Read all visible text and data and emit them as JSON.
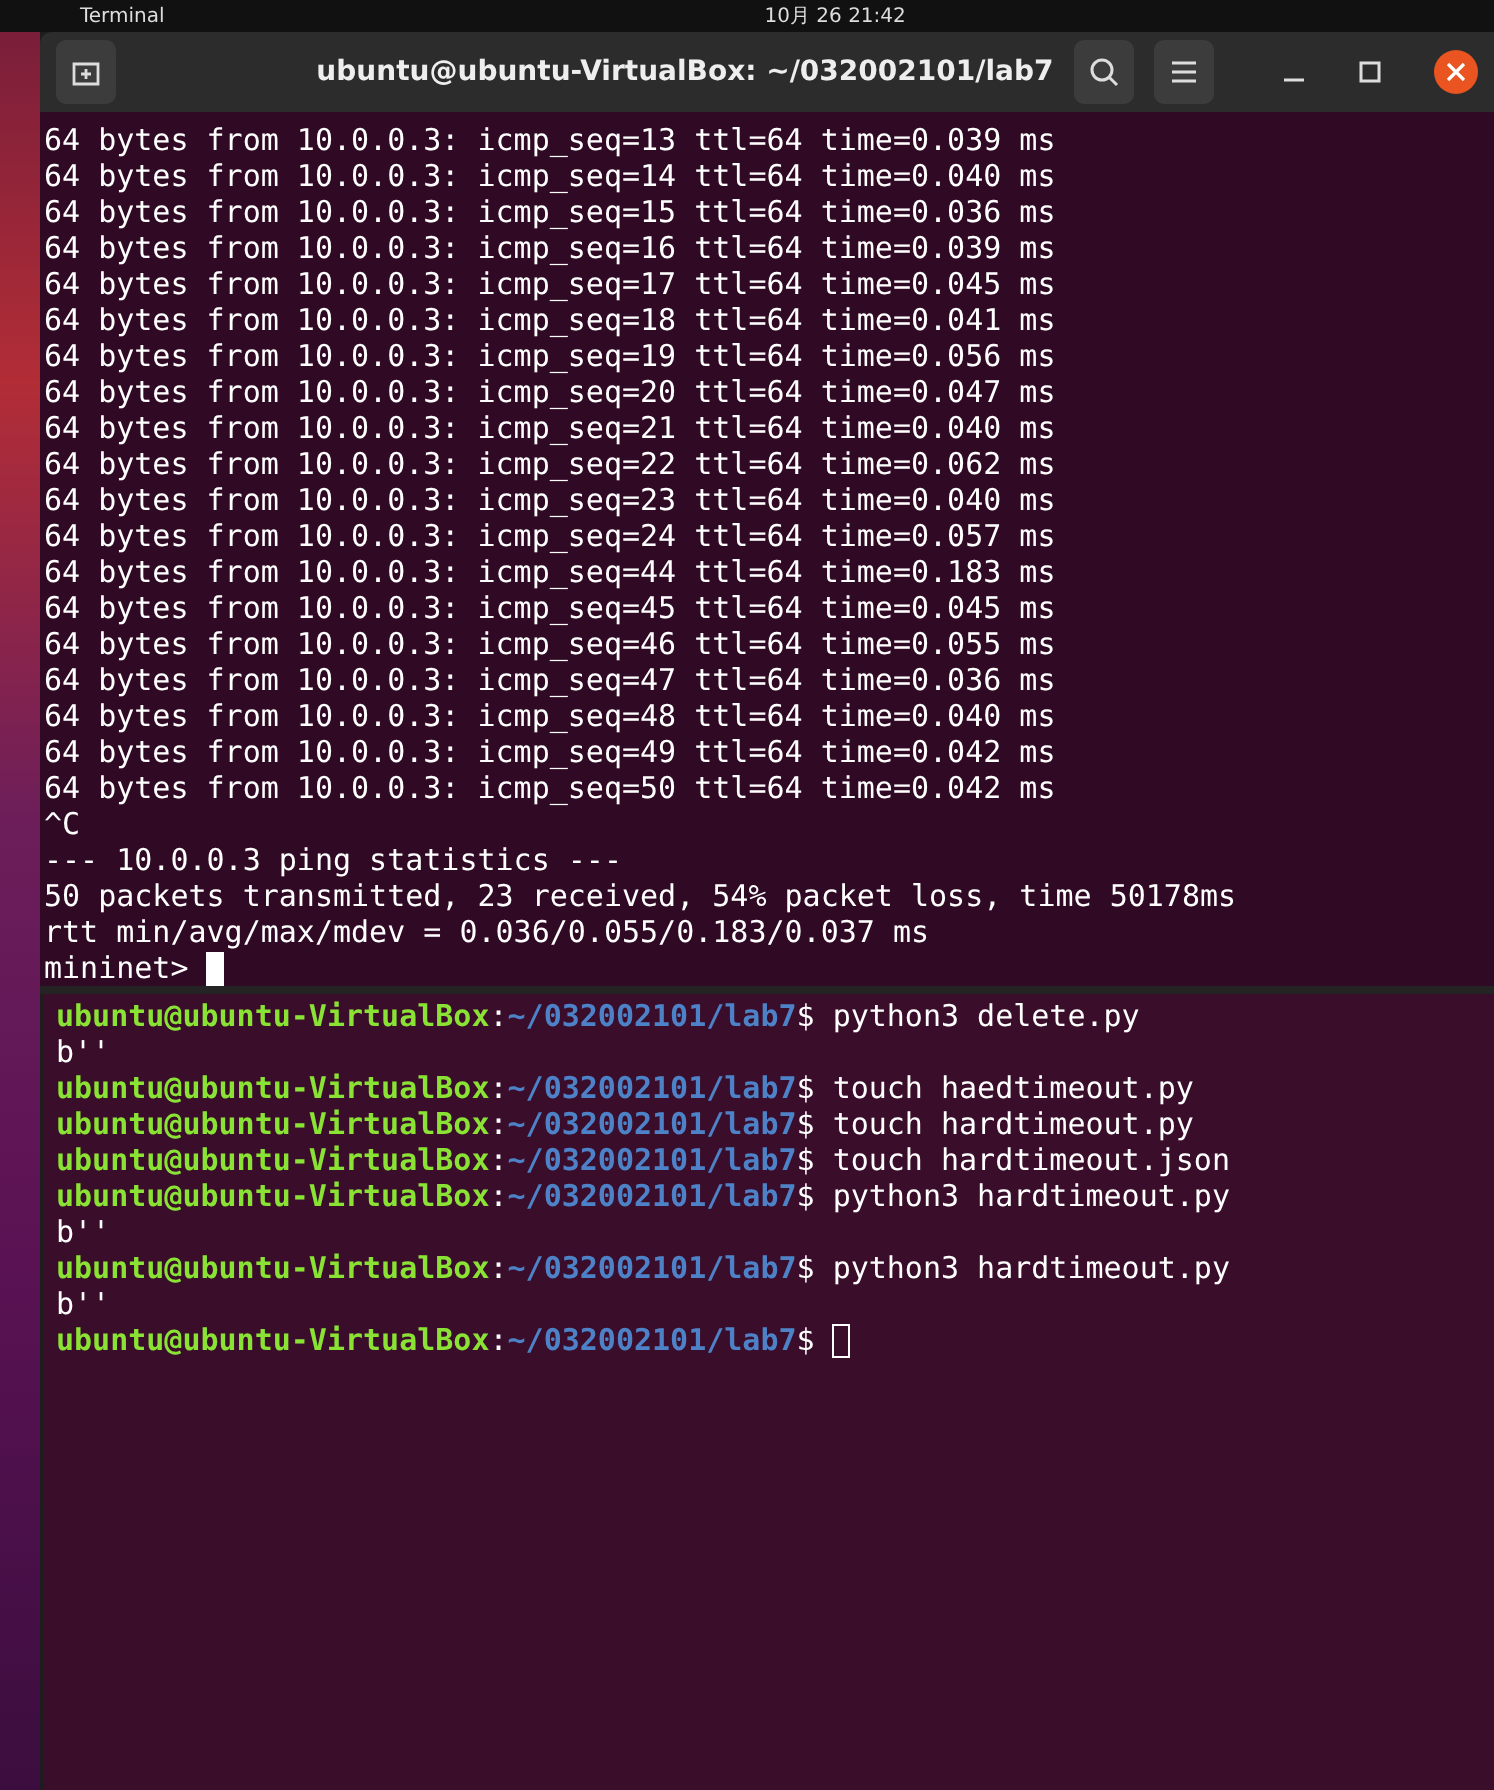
{
  "top_bar": {
    "app": "Terminal",
    "clock": "10月 26 21:42"
  },
  "window": {
    "title": "ubuntu@ubuntu-VirtualBox: ~/032002101/lab7"
  },
  "upper_pane": {
    "cursor_focused": true,
    "lines": [
      "64 bytes from 10.0.0.3: icmp_seq=13 ttl=64 time=0.039 ms",
      "64 bytes from 10.0.0.3: icmp_seq=14 ttl=64 time=0.040 ms",
      "64 bytes from 10.0.0.3: icmp_seq=15 ttl=64 time=0.036 ms",
      "64 bytes from 10.0.0.3: icmp_seq=16 ttl=64 time=0.039 ms",
      "64 bytes from 10.0.0.3: icmp_seq=17 ttl=64 time=0.045 ms",
      "64 bytes from 10.0.0.3: icmp_seq=18 ttl=64 time=0.041 ms",
      "64 bytes from 10.0.0.3: icmp_seq=19 ttl=64 time=0.056 ms",
      "64 bytes from 10.0.0.3: icmp_seq=20 ttl=64 time=0.047 ms",
      "64 bytes from 10.0.0.3: icmp_seq=21 ttl=64 time=0.040 ms",
      "64 bytes from 10.0.0.3: icmp_seq=22 ttl=64 time=0.062 ms",
      "64 bytes from 10.0.0.3: icmp_seq=23 ttl=64 time=0.040 ms",
      "64 bytes from 10.0.0.3: icmp_seq=24 ttl=64 time=0.057 ms",
      "64 bytes from 10.0.0.3: icmp_seq=44 ttl=64 time=0.183 ms",
      "64 bytes from 10.0.0.3: icmp_seq=45 ttl=64 time=0.045 ms",
      "64 bytes from 10.0.0.3: icmp_seq=46 ttl=64 time=0.055 ms",
      "64 bytes from 10.0.0.3: icmp_seq=47 ttl=64 time=0.036 ms",
      "64 bytes from 10.0.0.3: icmp_seq=48 ttl=64 time=0.040 ms",
      "64 bytes from 10.0.0.3: icmp_seq=49 ttl=64 time=0.042 ms",
      "64 bytes from 10.0.0.3: icmp_seq=50 ttl=64 time=0.042 ms",
      "^C",
      "--- 10.0.0.3 ping statistics ---",
      "50 packets transmitted, 23 received, 54% packet loss, time 50178ms",
      "rtt min/avg/max/mdev = 0.036/0.055/0.183/0.037 ms"
    ],
    "prompt": "mininet>"
  },
  "lower_pane": {
    "cursor_focused": false,
    "lines": [
      {
        "kind": "prompt",
        "user_host": "ubuntu@ubuntu-VirtualBox",
        "separator": ":",
        "path": "~/032002101/lab7",
        "prompt_char": "$",
        "command": "python3 delete.py"
      },
      {
        "kind": "output",
        "text": "b''"
      },
      {
        "kind": "prompt",
        "user_host": "ubuntu@ubuntu-VirtualBox",
        "separator": ":",
        "path": "~/032002101/lab7",
        "prompt_char": "$",
        "command": "touch haedtimeout.py"
      },
      {
        "kind": "prompt",
        "user_host": "ubuntu@ubuntu-VirtualBox",
        "separator": ":",
        "path": "~/032002101/lab7",
        "prompt_char": "$",
        "command": "touch hardtimeout.py"
      },
      {
        "kind": "prompt",
        "user_host": "ubuntu@ubuntu-VirtualBox",
        "separator": ":",
        "path": "~/032002101/lab7",
        "prompt_char": "$",
        "command": "touch hardtimeout.json"
      },
      {
        "kind": "prompt",
        "user_host": "ubuntu@ubuntu-VirtualBox",
        "separator": ":",
        "path": "~/032002101/lab7",
        "prompt_char": "$",
        "command": "python3 hardtimeout.py"
      },
      {
        "kind": "output",
        "text": "b''"
      },
      {
        "kind": "prompt",
        "user_host": "ubuntu@ubuntu-VirtualBox",
        "separator": ":",
        "path": "~/032002101/lab7",
        "prompt_char": "$",
        "command": "python3 hardtimeout.py"
      },
      {
        "kind": "output",
        "text": "b''"
      }
    ],
    "prompt": {
      "user_host": "ubuntu@ubuntu-VirtualBox",
      "separator": ":",
      "path": "~/032002101/lab7",
      "prompt_char": "$"
    }
  }
}
